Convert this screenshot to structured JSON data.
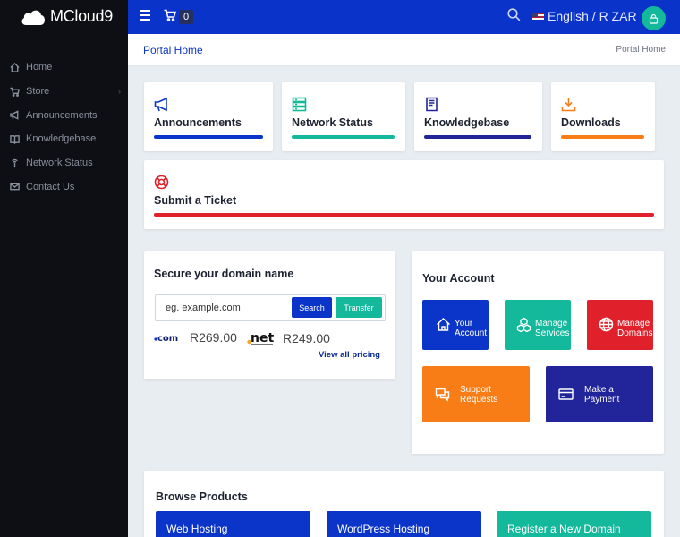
{
  "app": {
    "logo_text": "MCloud9"
  },
  "sidebar": {
    "items": [
      {
        "label": "Home",
        "icon": "home-icon"
      },
      {
        "label": "Store",
        "icon": "cart-icon"
      },
      {
        "label": "Announcements",
        "icon": "megaphone-icon"
      },
      {
        "label": "Knowledgebase",
        "icon": "book-icon"
      },
      {
        "label": "Network Status",
        "icon": "signal-icon"
      },
      {
        "label": "Contact Us",
        "icon": "mail-icon"
      }
    ]
  },
  "header": {
    "cart_count": "0",
    "language_currency": "English / R ZAR"
  },
  "breadcrumb": {
    "title": "Portal Home",
    "trail": "Portal Home"
  },
  "tiles": [
    {
      "label": "Announcements",
      "color": "#0b35c9"
    },
    {
      "label": "Network Status",
      "color": "#14b89a"
    },
    {
      "label": "Knowledgebase",
      "color": "#22249a"
    },
    {
      "label": "Downloads",
      "color": "#f97d16"
    }
  ],
  "ticket": {
    "label": "Submit a Ticket",
    "color": "#e0202b"
  },
  "domain": {
    "title": "Secure your domain name",
    "placeholder": "eg. example.com",
    "search_label": "Search",
    "transfer_label": "Transfer",
    "tlds": [
      {
        "name": "com",
        "price": "R269.00"
      },
      {
        "name": "net",
        "price": "R249.00"
      }
    ],
    "view_pricing": "View all pricing"
  },
  "account": {
    "title": "Your Account",
    "tiles": [
      {
        "label_1": "Your",
        "label_2": "Account",
        "color": "#0b35c9"
      },
      {
        "label_1": "Manage",
        "label_2": "Services",
        "color": "#14b89a"
      },
      {
        "label_1": "Manage",
        "label_2": "Domains",
        "color": "#e0202b"
      },
      {
        "label_1": "Support",
        "label_2": "Requests",
        "color": "#f97d16"
      },
      {
        "label_1": "Make a",
        "label_2": "Payment",
        "color": "#22249a"
      }
    ]
  },
  "products": {
    "title": "Browse Products",
    "items": [
      {
        "label": "Web Hosting",
        "color": "#0b35c9"
      },
      {
        "label": "WordPress Hosting",
        "color": "#0b35c9"
      },
      {
        "label": "Register a New Domain",
        "color": "#14b89a"
      }
    ]
  }
}
